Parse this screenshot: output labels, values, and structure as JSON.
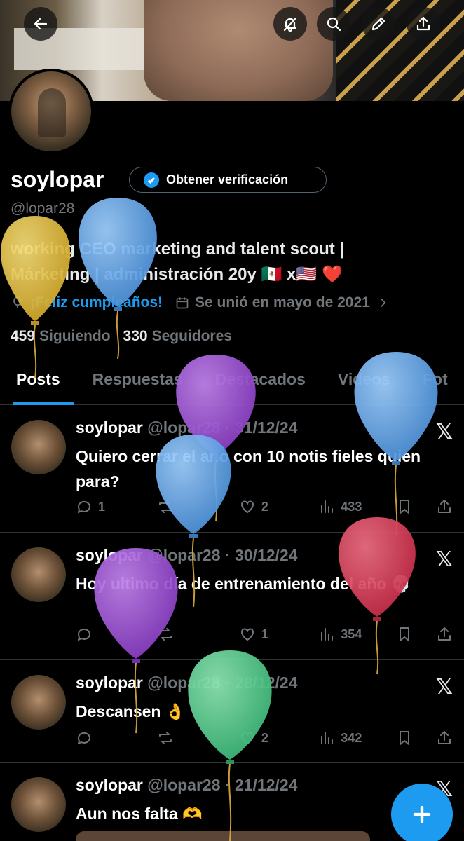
{
  "header": {
    "back_icon": "arrow-left-icon",
    "actions": [
      "no-bell-icon",
      "search-icon",
      "pencil-icon",
      "share-icon"
    ]
  },
  "profile": {
    "display_name": "soylopar",
    "verify_button": "Obtener verificación",
    "handle": "@lopar28",
    "bio_line1": "working CEO marketing and talent scout |",
    "bio_line2": "Márketing | administración 20y 🇲🇽 x🇺🇸 ❤️",
    "birthday": "¡Feliz cumpleaños!",
    "joined": "Se unió en mayo de 2021",
    "following_count": "459",
    "following_label": "Siguiendo",
    "followers_count": "330",
    "followers_label": "Seguidores"
  },
  "tabs": [
    "Posts",
    "Respuestas",
    "Destacados",
    "Videos",
    "Fot"
  ],
  "posts": [
    {
      "name": "soylopar",
      "handle_date": "@lopar28 · 31/12/24",
      "text": "Quiero cerrar el año con 10 notis fieles quien para?",
      "replies": "1",
      "retweets": "",
      "likes": "2",
      "views": "433"
    },
    {
      "name": "soylopar",
      "handle_date": "@lopar28 · 30/12/24",
      "text": "Hoy ultimo día de entrenamiento del año 💀",
      "replies": "",
      "retweets": "",
      "likes": "1",
      "views": "354"
    },
    {
      "name": "soylopar",
      "handle_date": "@lopar28 · 28/12/24",
      "text": "Descansen 👌",
      "replies": "",
      "retweets": "",
      "likes": "2",
      "views": "342"
    },
    {
      "name": "soylopar",
      "handle_date": "@lopar28 · 21/12/24",
      "text": "Aun nos falta 🫶",
      "replies": "",
      "retweets": "",
      "likes": "",
      "views": ""
    }
  ],
  "colors": {
    "accent": "#1d9bf0",
    "muted": "#71767b",
    "background": "#000000"
  }
}
